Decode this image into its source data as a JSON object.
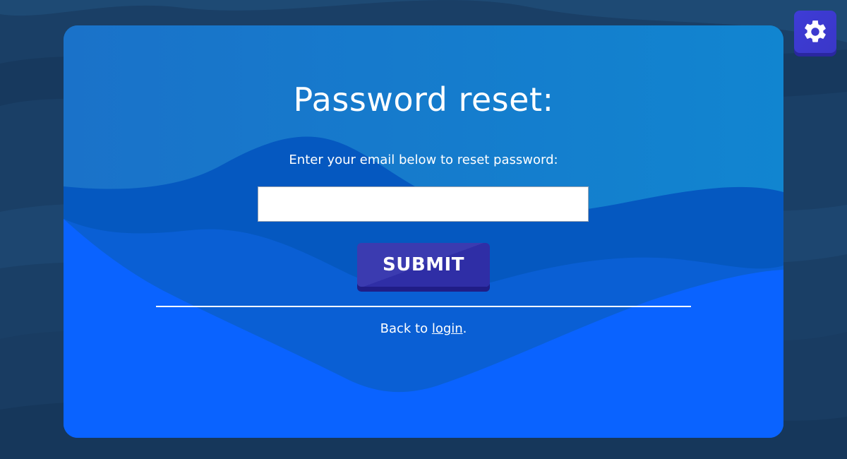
{
  "colors": {
    "page_background": "#1b4066",
    "card_top": "#1176cc",
    "card_bottom": "#0a63ff",
    "button": "#3b3bb0",
    "text": "#ffffff"
  },
  "settings": {
    "icon": "gear-icon"
  },
  "form": {
    "title": "Password reset:",
    "instructions": "Enter your email below to reset password:",
    "email_value": "",
    "submit_label": "SUBMIT"
  },
  "footer": {
    "back_prefix": "Back to ",
    "login_link": "login",
    "back_suffix": "."
  }
}
